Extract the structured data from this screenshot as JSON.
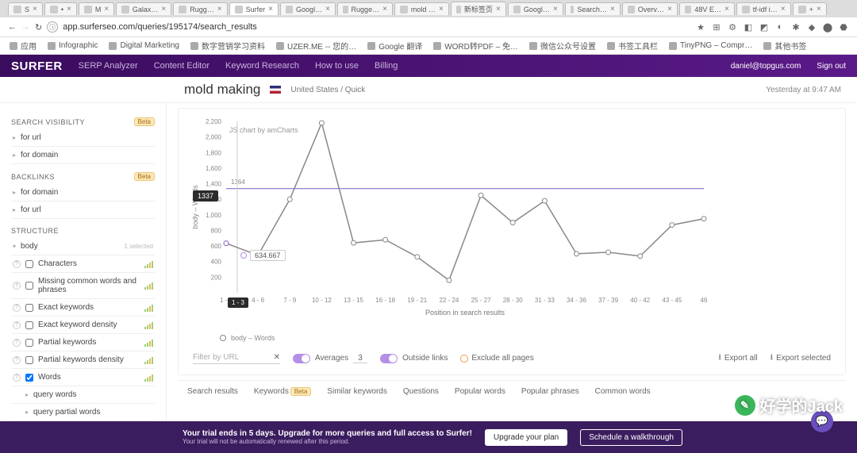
{
  "browser": {
    "tabs": [
      {
        "label": "S"
      },
      {
        "label": "•"
      },
      {
        "label": "M"
      },
      {
        "label": "Galax…"
      },
      {
        "label": "Rugg…"
      },
      {
        "label": "Surfer",
        "active": true
      },
      {
        "label": "Googl…"
      },
      {
        "label": "Rugge…"
      },
      {
        "label": "mold …"
      },
      {
        "label": "新标签页"
      },
      {
        "label": "Googl…"
      },
      {
        "label": "Search…"
      },
      {
        "label": "Overv…"
      },
      {
        "label": "48V E…"
      },
      {
        "label": "tf-idf i…"
      },
      {
        "label": "+"
      }
    ],
    "url": "app.surferseo.com/queries/195174/search_results",
    "bookmarks": [
      {
        "label": "应用"
      },
      {
        "label": "Infographic"
      },
      {
        "label": "Digital Marketing"
      },
      {
        "label": "数字营销学习资料"
      },
      {
        "label": "UZER.ME -- 您的…"
      },
      {
        "label": "Google 翻译"
      },
      {
        "label": "WORD转PDF – 免…"
      },
      {
        "label": "微信公众号设置"
      },
      {
        "label": "书签工具栏"
      },
      {
        "label": "TinyPNG – Compr…"
      },
      {
        "label": "其他书签"
      }
    ]
  },
  "nav": {
    "brand": "SURFER",
    "links": [
      "SERP Analyzer",
      "Content Editor",
      "Keyword Research",
      "How to use",
      "Billing"
    ],
    "user": "daniel@topgus.com",
    "signout": "Sign out"
  },
  "header": {
    "title": "mold making",
    "location": "United States / Quick",
    "timestamp": "Yesterday at 9:47 AM"
  },
  "sidebar": {
    "vis": {
      "title": "SEARCH VISIBILITY",
      "beta": "Beta",
      "items": [
        "for url",
        "for domain"
      ]
    },
    "back": {
      "title": "BACKLINKS",
      "beta": "Beta",
      "items": [
        "for domain",
        "for url"
      ]
    },
    "struct": {
      "title": "STRUCTURE",
      "body": "body",
      "hint": "1 selected",
      "items": [
        {
          "label": "Characters"
        },
        {
          "label": "Missing common words and phrases"
        },
        {
          "label": "Exact keywords"
        },
        {
          "label": "Exact keyword density"
        },
        {
          "label": "Partial keywords"
        },
        {
          "label": "Partial keywords density"
        },
        {
          "label": "Words",
          "checked": true
        },
        {
          "label": "query words",
          "sub": true
        },
        {
          "label": "query partial words",
          "sub": true
        }
      ]
    }
  },
  "chart_data": {
    "type": "line",
    "title": "",
    "xlabel": "Position in search results",
    "ylabel": "body – Words",
    "ylim": [
      0,
      2200
    ],
    "y_ticks": [
      200,
      400,
      600,
      800,
      1000,
      1200,
      1337,
      1400,
      1600,
      1800,
      2000,
      2200
    ],
    "categories": [
      "1 - 3",
      "4 - 6",
      "7 - 9",
      "10 - 12",
      "13 - 15",
      "16 - 18",
      "19 - 21",
      "22 - 24",
      "25 - 27",
      "28 - 30",
      "31 - 33",
      "34 - 36",
      "37 - 39",
      "40 - 42",
      "43 - 45",
      "46"
    ],
    "series": [
      {
        "name": "body – Words",
        "values": [
          634.667,
          480,
          1200,
          2180,
          640,
          680,
          460,
          160,
          1250,
          900,
          1180,
          500,
          520,
          470,
          870,
          950
        ]
      }
    ],
    "average_line": 1337,
    "grid_at": 1364,
    "selected_x": "1 - 3",
    "tooltip_value": "634.667",
    "attrib": "JS chart by amCharts",
    "legend": "body – Words"
  },
  "filters": {
    "url_placeholder": "Filter by URL",
    "averages": "Averages",
    "averages_n": "3",
    "outside": "Outside links",
    "exclude": "Exclude all pages",
    "export_all": "Export all",
    "export_sel": "Export selected"
  },
  "bottom_tabs": {
    "items": [
      "Search results",
      "Keywords",
      "Similar keywords",
      "Questions",
      "Popular words",
      "Popular phrases",
      "Common words"
    ],
    "beta": "Beta"
  },
  "trial": {
    "line1": "Your trial ends in 5 days. Upgrade for more queries and full access to Surfer!",
    "line2": "Your trial will not be automatically renewed after this period.",
    "btn1": "Upgrade your plan",
    "btn2": "Schedule a walkthrough"
  },
  "watermark": "好学的Jack"
}
